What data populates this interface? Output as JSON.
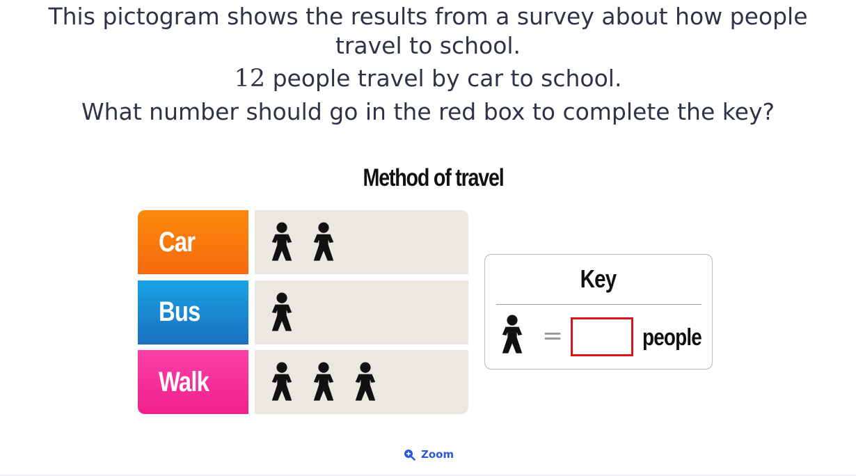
{
  "question": {
    "line1": "This pictogram shows the results from a survey about how people",
    "line2": "travel to school.",
    "line3_number": "12",
    "line3_rest": " people travel by car to school.",
    "line4": "What number should go in the red box to complete the key?"
  },
  "chart_data": {
    "type": "pictogram",
    "title": "Method of travel",
    "categories": [
      "Car",
      "Bus",
      "Walk"
    ],
    "values": [
      2,
      1,
      3
    ],
    "value_unit": "symbols",
    "colors": [
      "#fa7a12",
      "#1a8fd8",
      "#f02a9a"
    ],
    "key": {
      "title": "Key",
      "equals": "=",
      "unit": "people",
      "value": ""
    }
  },
  "zoom": {
    "label": "Zoom",
    "icon": "zoom-in-icon"
  }
}
